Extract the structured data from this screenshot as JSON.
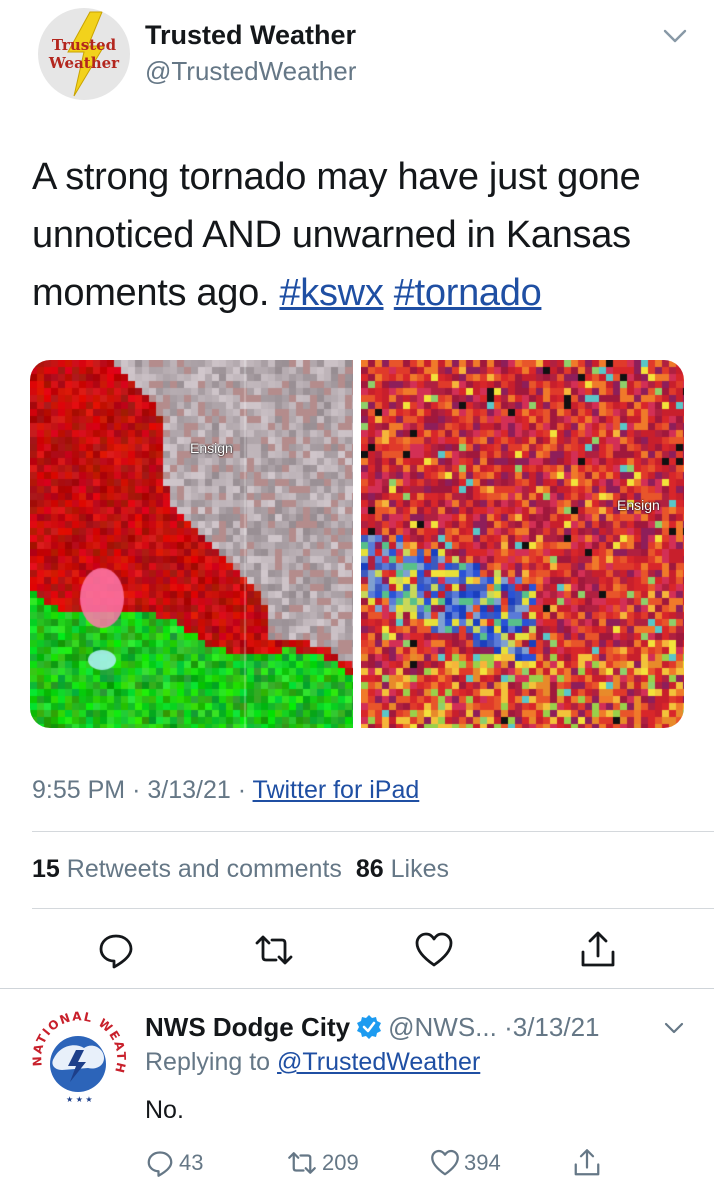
{
  "tweet": {
    "avatar_text": [
      "Trusted",
      "Weather"
    ],
    "author_name": "Trusted Weather",
    "author_handle": "@TrustedWeather",
    "text_plain": "A strong tornado may have just gone unnoticed AND unwarned in Kansas moments ago.",
    "hashtags": [
      "#kswx",
      "#tornado"
    ],
    "media": {
      "left_label": "Ensign",
      "right_label": "Ensign"
    },
    "time": "9:55 PM",
    "date": "3/13/21",
    "source": "Twitter for iPad",
    "retweets_count": "15",
    "retweets_label": "Retweets and comments",
    "likes_count": "86",
    "likes_label": "Likes",
    "actions": [
      "reply-icon",
      "retweet-icon",
      "like-icon",
      "share-icon"
    ]
  },
  "reply": {
    "avatar_text": "NATIONAL WEATHER SERVICE",
    "author_name": "NWS Dodge City",
    "handle": "@NWS...",
    "date": "3/13/21",
    "replying_prefix": "Replying to",
    "replying_to": "@TrustedWeather",
    "text": "No.",
    "reply_count": "43",
    "retweet_count": "209",
    "like_count": "394"
  },
  "colors": {
    "link": "#1f4fa3",
    "secondary_text": "#657786",
    "primary_text": "#14171a",
    "divider": "#d4d8dc"
  }
}
